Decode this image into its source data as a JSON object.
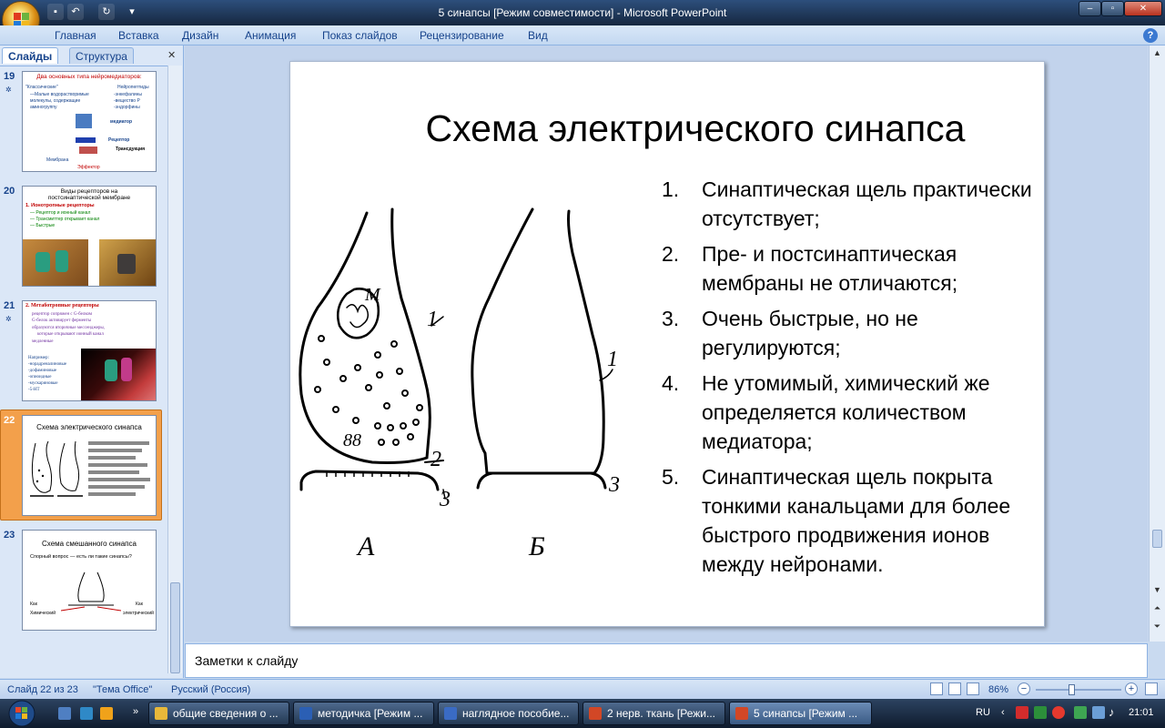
{
  "window": {
    "title": "5 синапсы [Режим совместимости] - Microsoft PowerPoint"
  },
  "ribbon": {
    "tabs": [
      "Главная",
      "Вставка",
      "Дизайн",
      "Анимация",
      "Показ слайдов",
      "Рецензирование",
      "Вид"
    ]
  },
  "panel": {
    "tab_slides": "Слайды",
    "tab_outline": "Структура"
  },
  "thumbs": [
    {
      "num": "19",
      "title": "Два основных типа нейромедиаторов:",
      "lines": [
        "\"Классические\"",
        "Нейропептиды",
        "—Малые водорастворимые",
        "-энкефалины",
        "молекулы, содержащие",
        "-вещество Р",
        "аминогруппу",
        "-эндорфины",
        "медиатор",
        "Рецептор",
        "Трансдукция",
        "Мембрана",
        "Эффектор"
      ]
    },
    {
      "num": "20",
      "title": "Виды рецепторов на постсинаптической мембране",
      "lines": [
        "1. Ионотропные рецепторы",
        "— Рецептор и ионный канал",
        "— Трансмиттер открывает канал",
        "— Быстрые"
      ]
    },
    {
      "num": "21",
      "title": "2. Метаботропные рецепторы",
      "lines": [
        "рецептор сопряжен с G-белком",
        "G-белок активирует ферменты",
        "образуются вторичные мессенджеры,",
        "которые открывают ионный канал",
        "медленные",
        "Например:",
        "-норадреналиновые",
        "-дофаминовые",
        "-опиоидные",
        "-мускариновые",
        "-5-HT"
      ]
    },
    {
      "num": "22",
      "title": "Схема электрического синапса"
    },
    {
      "num": "23",
      "title": "Схема смешанного синапса",
      "lines": [
        "Спорный вопрос — есть ли такие синапсы?",
        "Как",
        "Как",
        "Химический",
        "электрический"
      ]
    }
  ],
  "slide": {
    "title": "Схема электрического синапса",
    "items": [
      {
        "n": "1.",
        "text": "Синаптическая щель практически отсутствует;"
      },
      {
        "n": "2.",
        "text": "Пре- и постсинаптическая мембраны не отличаются;"
      },
      {
        "n": "3.",
        "text": "Очень быстрые, но не регулируются;"
      },
      {
        "n": "4.",
        "text": "Не утомимый, химический же определяется количеством медиатора;"
      },
      {
        "n": "5.",
        "text": "Синаптическая щель покрыта тонкими канальцами для более быстрого продвижения ионов между нейронами."
      }
    ],
    "diagram_labels": {
      "a": "А",
      "b": "Б",
      "m": "М",
      "l1": "1",
      "l2": "2",
      "l3": "3",
      "l1b": "1",
      "l3b": "3",
      "eight": "88"
    }
  },
  "notes": {
    "placeholder": "Заметки к слайду"
  },
  "status": {
    "slide": "Слайд 22 из 23",
    "theme": "\"Тема Office\"",
    "lang": "Русский (Россия)",
    "zoom": "86%",
    "zoom_level": 0.43
  },
  "taskbar": {
    "items": [
      {
        "label": "общие сведения о ...",
        "color": "#e8b83a"
      },
      {
        "label": "методичка [Режим ...",
        "color": "#2b5fb4"
      },
      {
        "label": "наглядное пособие...",
        "color": "#3a6bc4"
      },
      {
        "label": "2 нерв. ткань [Режи...",
        "color": "#d24726"
      },
      {
        "label": "5 синапсы [Режим ...",
        "color": "#d24726"
      }
    ],
    "lang": "RU",
    "clock": "21:01"
  }
}
